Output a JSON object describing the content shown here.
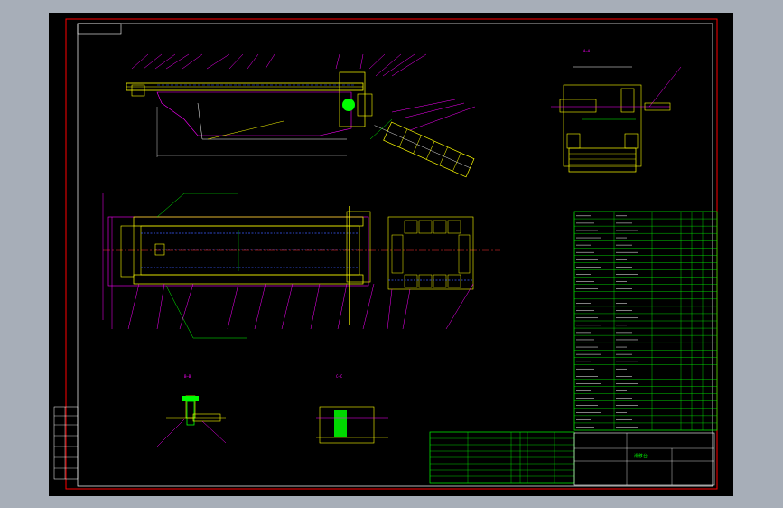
{
  "viewport": {
    "background": "#000000",
    "frame_color": "#ff0000",
    "line_colors": {
      "yellow": "#ffff00",
      "magenta": "#ff00ff",
      "green": "#00ff00",
      "cyan": "#00ffff",
      "white": "#ffffff",
      "red": "#ff3030",
      "blue": "#3a5cff"
    }
  },
  "title_block": {
    "drawing_title": "滑移台",
    "drawing_subtitle": "",
    "drawing_number": ""
  },
  "parts_list": {
    "row_count": 30
  },
  "bom_bottom": {
    "row_count": 8
  }
}
